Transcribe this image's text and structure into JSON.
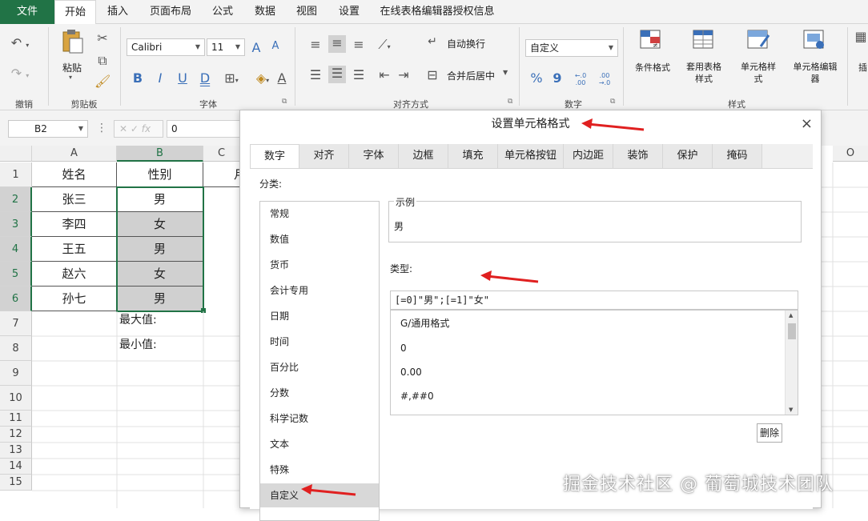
{
  "tabs": [
    "文件",
    "开始",
    "插入",
    "页面布局",
    "公式",
    "数据",
    "视图",
    "设置",
    "在线表格编辑器授权信息"
  ],
  "ribbon": {
    "undo_label": "撤销",
    "clipboard": {
      "paste_label": "粘贴",
      "group_label": "剪贴板"
    },
    "font": {
      "name": "Calibri",
      "size": "11",
      "group_label": "字体",
      "grow_glyph": "A⁺",
      "shrink_glyph": "A⁻",
      "bold": "B",
      "italic": "I",
      "underline": "U",
      "double_underline": "D"
    },
    "alignment": {
      "wrap_label": "自动换行",
      "merge_label": "合并后居中",
      "group_label": "对齐方式"
    },
    "number": {
      "format_value": "自定义",
      "percent_glyph": "%",
      "comma_glyph": "9",
      "inc_decimal": "←.0 .00",
      "dec_decimal": ".00 →.0",
      "group_label": "数字"
    },
    "styles": {
      "conditional": "条件格式",
      "table_style": "套用表格样式",
      "cell_style": "单元格样式",
      "cell_editor": "单元格编辑器",
      "group_label": "样式"
    },
    "next": "插"
  },
  "formula_bar": {
    "cell_ref": "B2",
    "fx": "fx",
    "value": "0"
  },
  "sheet": {
    "columns": [
      "A",
      "B",
      "C"
    ],
    "extra_col": "O",
    "rows": [
      "1",
      "2",
      "3",
      "4",
      "5",
      "6",
      "7",
      "8",
      "9",
      "10",
      "11",
      "12",
      "13",
      "14",
      "15"
    ],
    "header_row": [
      "姓名",
      "性别",
      "月"
    ],
    "data": [
      [
        "张三",
        "男"
      ],
      [
        "李四",
        "女"
      ],
      [
        "王五",
        "男"
      ],
      [
        "赵六",
        "女"
      ],
      [
        "孙七",
        "男"
      ]
    ],
    "max_label": "最大值:",
    "min_label": "最小值:"
  },
  "dialog": {
    "title": "设置单元格格式",
    "close": "×",
    "tabs": [
      "数字",
      "对齐",
      "字体",
      "边框",
      "填充",
      "单元格按钮",
      "内边距",
      "装饰",
      "保护",
      "掩码"
    ],
    "category_label": "分类:",
    "categories": [
      "常规",
      "数值",
      "货币",
      "会计专用",
      "日期",
      "时间",
      "百分比",
      "分数",
      "科学记数",
      "文本",
      "特殊",
      "自定义"
    ],
    "selected_category": "自定义",
    "sample_label": "示例",
    "sample_value": "男",
    "type_label": "类型:",
    "type_value": "[=0]\"男\";[=1]\"女\"",
    "formats": [
      "G/通用格式",
      "0",
      "0.00",
      "#,##0"
    ],
    "delete_label": "删除"
  },
  "watermark": "掘金技术社区 @ 葡萄城技术团队",
  "colors": {
    "excel_green": "#217346",
    "arrow_red": "#e02020"
  }
}
